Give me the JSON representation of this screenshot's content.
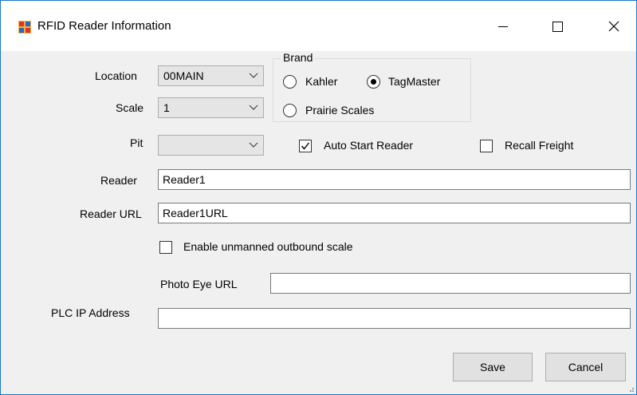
{
  "window": {
    "title": "RFID Reader Information",
    "accent": "#1979ca"
  },
  "titlebar_buttons": {
    "minimize_icon": "minimize-icon",
    "maximize_icon": "maximize-icon",
    "close_icon": "close-icon"
  },
  "form": {
    "location": {
      "label": "Location",
      "value": "00MAIN"
    },
    "scale": {
      "label": "Scale",
      "value": "1"
    },
    "pit": {
      "label": "Pit",
      "value": ""
    },
    "brand": {
      "title": "Brand",
      "options": [
        {
          "label": "Kahler",
          "selected": false
        },
        {
          "label": "TagMaster",
          "selected": true
        },
        {
          "label": "Prairie Scales",
          "selected": false
        }
      ]
    },
    "auto_start_reader": {
      "label": "Auto Start Reader",
      "checked": true
    },
    "recall_freight": {
      "label": "Recall Freight",
      "checked": false
    },
    "reader": {
      "label": "Reader",
      "value": "Reader1"
    },
    "reader_url": {
      "label": "Reader URL",
      "value": "Reader1URL"
    },
    "unmanned": {
      "label": "Enable unmanned outbound scale",
      "checked": false
    },
    "photo_eye_url": {
      "label": "Photo Eye URL",
      "value": ""
    },
    "plc_ip": {
      "label": "PLC IP Address",
      "value": ""
    }
  },
  "buttons": {
    "save": "Save",
    "cancel": "Cancel"
  }
}
